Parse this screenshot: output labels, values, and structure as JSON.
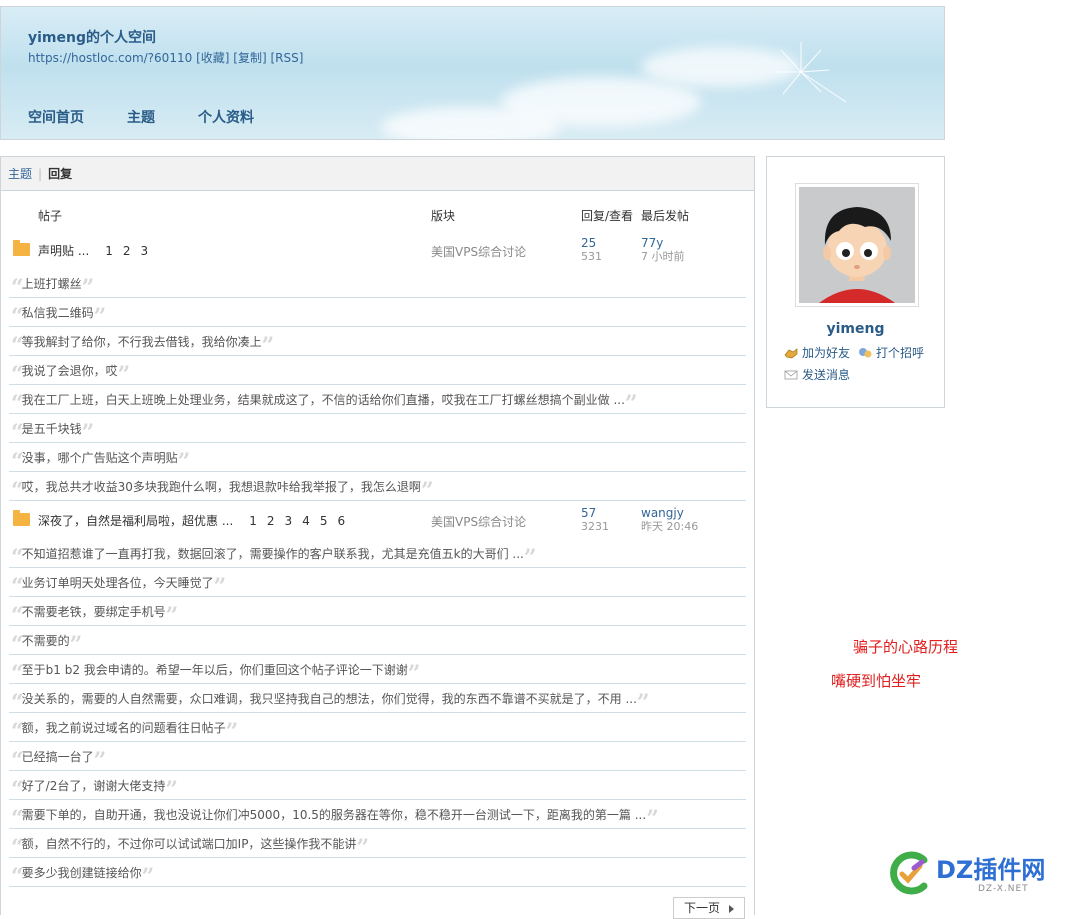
{
  "header": {
    "space_title": "yimeng的个人空间",
    "url": "https://hostloc.com/?60110",
    "url_actions": [
      "[收藏]",
      "[复制]",
      "[RSS]"
    ],
    "nav": [
      "空间首页",
      "主题",
      "个人资料"
    ]
  },
  "tabs": {
    "topics": "主题",
    "replies": "回复",
    "active": "回复"
  },
  "columns": {
    "post": "帖子",
    "forum": "版块",
    "reply_view": "回复/查看",
    "last": "最后发帖"
  },
  "threads": [
    {
      "title": "声明贴 ...",
      "pages": [
        "1",
        "2",
        "3"
      ],
      "forum": "美国VPS综合讨论",
      "replies": "25",
      "views": "531",
      "last_user": "77y",
      "last_time": "7 小时前",
      "reply_snippets": [
        "上班打螺丝",
        "私信我二维码",
        "等我解封了给你，不行我去借钱，我给你凑上",
        "我说了会退你，哎",
        "我在工厂上班，白天上班晚上处理业务，结果就成这了，不信的话给你们直播，哎我在工厂打螺丝想搞个副业做 ...",
        "是五千块钱",
        "没事，哪个广告贴这个声明贴",
        "哎，我总共才收益30多块我跑什么啊，我想退款咔给我举报了，我怎么退啊"
      ]
    },
    {
      "title": "深夜了，自然是福利局啦，超优惠 ...",
      "pages": [
        "1",
        "2",
        "3",
        "4",
        "5",
        "6"
      ],
      "forum": "美国VPS综合讨论",
      "replies": "57",
      "views": "3231",
      "last_user": "wangjy",
      "last_time": "昨天 20:46",
      "reply_snippets": [
        "不知道招惹谁了一直再打我，数据回滚了，需要操作的客户联系我，尤其是充值五k的大哥们 ...",
        "业务订单明天处理各位，今天睡觉了",
        "不需要老铁，要绑定手机号",
        "不需要的",
        "至于b1 b2 我会申请的。希望一年以后，你们重回这个帖子评论一下谢谢",
        "没关系的，需要的人自然需要，众口难调，我只坚持我自己的想法，你们觉得，我的东西不靠谱不买就是了，不用 ...",
        "额，我之前说过域名的问题看往日帖子",
        "已经搞一台了",
        "好了/2台了，谢谢大佬支持",
        "需要下单的，自助开通，我也没说让你们冲5000，10.5的服务器在等你，稳不稳开一台测试一下，距离我的第一篇 ...",
        "额，自然不行的，不过你可以试试端口加IP，这些操作我不能讲",
        "要多少我创建链接给你"
      ]
    }
  ],
  "pagination": {
    "next": "下一页"
  },
  "profile": {
    "username": "yimeng",
    "add_friend": "加为好友",
    "greet": "打个招呼",
    "send_message": "发送消息"
  },
  "annotations": [
    "骗子的心路历程",
    "嘴硬到怕坐牢"
  ],
  "watermark": {
    "brand": "DZ插件网",
    "sub": "DZ-X.NET"
  },
  "colors": {
    "link": "#336699",
    "title": "#2a5c88",
    "annotation": "#e02020",
    "folder": "#f5b342"
  },
  "icons": [
    "folder-icon",
    "quote-open-icon",
    "quote-close-icon",
    "add-friend-icon",
    "greet-icon",
    "mail-icon",
    "arrow-right-icon"
  ]
}
